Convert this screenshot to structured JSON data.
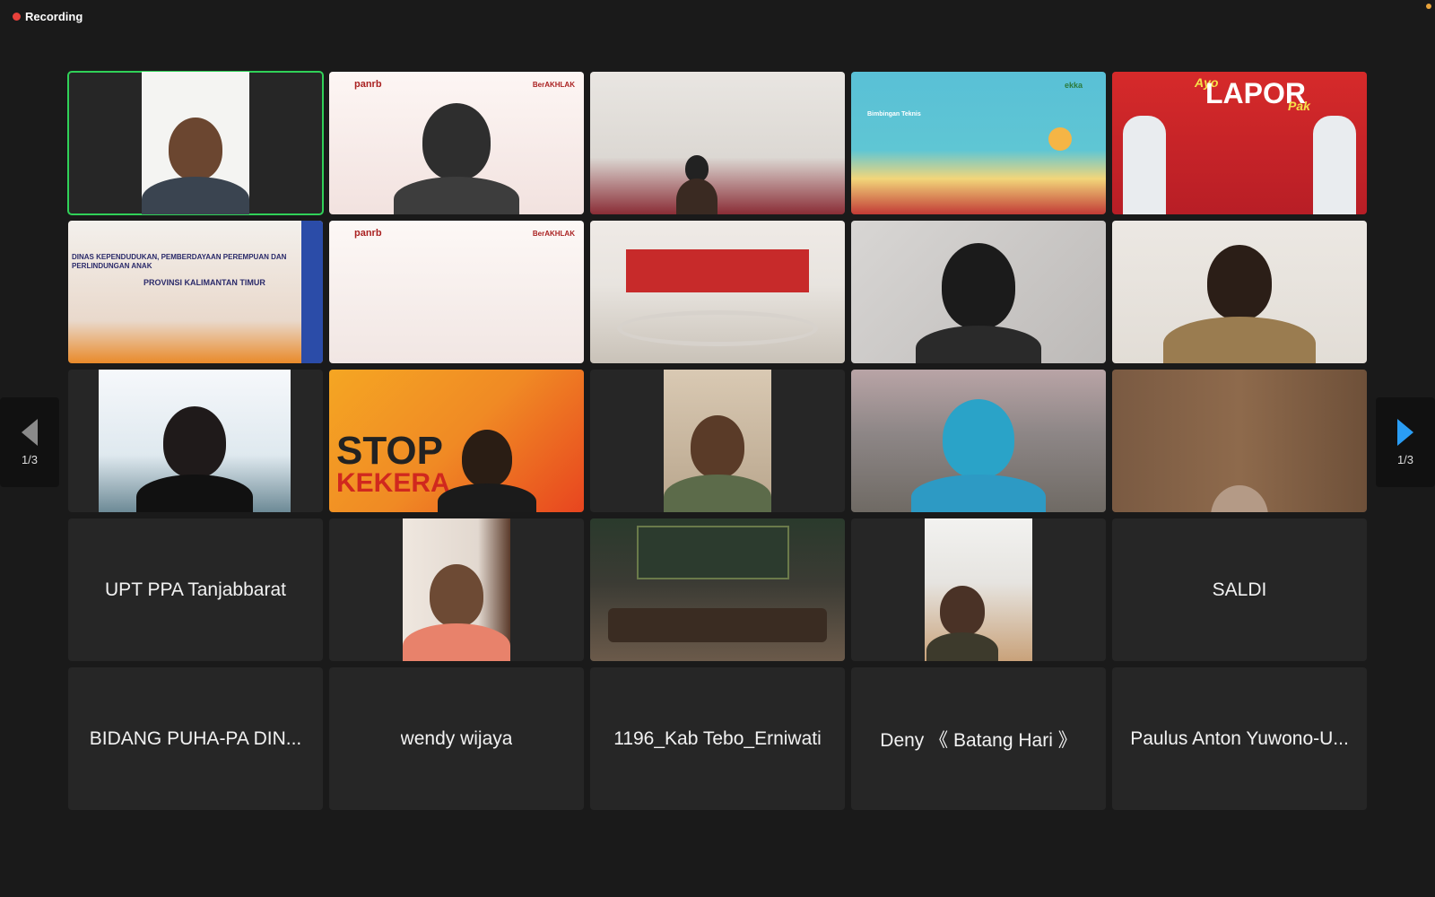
{
  "recording": {
    "label": "Recording"
  },
  "pagination": {
    "left_label": "1/3",
    "right_label": "1/3"
  },
  "colors": {
    "speaking_border": "#30d158",
    "next_arrow": "#2a9df4",
    "recording_dot": "#e8413b"
  },
  "tiles": {
    "t1": {
      "type": "video"
    },
    "t2": {
      "type": "video",
      "logo": "panrb",
      "tag": "BerAKHLAK"
    },
    "t3": {
      "type": "video"
    },
    "t4": {
      "type": "video",
      "small_text": "Bimbingan Teknis",
      "brand": "ekka"
    },
    "t5": {
      "type": "video",
      "title": "LAPOR",
      "script": "Ayo",
      "suffix": "Pak"
    },
    "t6": {
      "type": "video",
      "line1": "DINAS KEPENDUDUKAN, PEMBERDAYAAN PEREMPUAN DAN PERLINDUNGAN ANAK",
      "line2": "PROVINSI KALIMANTAN TIMUR"
    },
    "t7": {
      "type": "video",
      "logo": "panrb",
      "tag": "BerAKHLAK"
    },
    "t8": {
      "type": "video"
    },
    "t9": {
      "type": "video"
    },
    "t10": {
      "type": "video"
    },
    "t11": {
      "type": "video"
    },
    "t12": {
      "type": "video",
      "line1": "STOP",
      "line2": "KEKERA"
    },
    "t13": {
      "type": "video"
    },
    "t14": {
      "type": "video"
    },
    "t15": {
      "type": "video"
    },
    "t16": {
      "type": "name",
      "name": "UPT PPA Tanjabbarat"
    },
    "t17": {
      "type": "video"
    },
    "t18": {
      "type": "video"
    },
    "t19": {
      "type": "video"
    },
    "t20": {
      "type": "name",
      "name": "SALDI"
    },
    "t21": {
      "type": "name",
      "name": "BIDANG PUHA-PA  DIN..."
    },
    "t22": {
      "type": "name",
      "name": "wendy wijaya"
    },
    "t23": {
      "type": "name",
      "name": "1196_Kab Tebo_Erniwati"
    },
    "t24": {
      "type": "name",
      "name": "Deny 《 Batang Hari 》"
    },
    "t25": {
      "type": "name",
      "name": "Paulus Anton Yuwono-U..."
    }
  }
}
